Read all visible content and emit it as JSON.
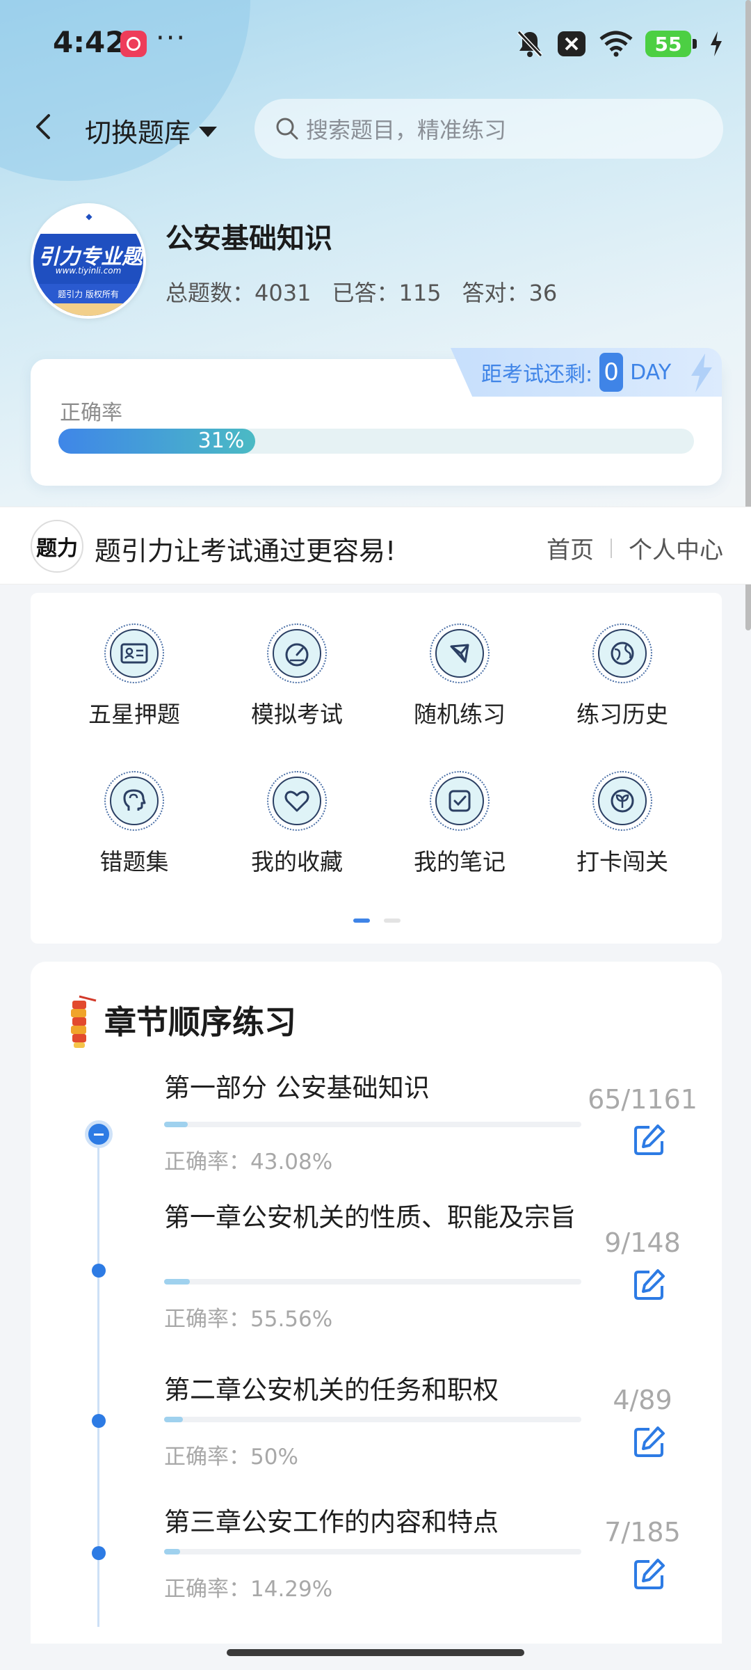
{
  "status_bar": {
    "time": "4:42",
    "dots": "···",
    "battery": "55"
  },
  "header": {
    "switch_label": "切换题库",
    "search_placeholder": "搜索题目，精准练习"
  },
  "logo": {
    "band_text": "引力专业题",
    "url": "www.tiyinli.com",
    "copyright": "题引力 版权所有"
  },
  "bank": {
    "title": "公安基础知识",
    "total_label": "总题数：4031",
    "answered_label": "已答：115",
    "correct_label": "答对：36"
  },
  "accuracy": {
    "label": "正确率",
    "percent_text": "31%",
    "value": 0.31,
    "countdown_label": "距考试还剩:",
    "countdown_days": "0",
    "countdown_unit": "DAY"
  },
  "slogan_bar": {
    "logo_text": "题力",
    "slogan": "题引力让考试通过更容易!",
    "nav_home": "首页",
    "nav_profile": "个人中心"
  },
  "menu": {
    "items": [
      {
        "label": "五星押题",
        "icon": "id-card-icon"
      },
      {
        "label": "模拟考试",
        "icon": "speedometer-icon"
      },
      {
        "label": "随机练习",
        "icon": "network-icon"
      },
      {
        "label": "练习历史",
        "icon": "globe-icon"
      },
      {
        "label": "错题集",
        "icon": "head-icon"
      },
      {
        "label": "我的收藏",
        "icon": "heart-icon"
      },
      {
        "label": "我的笔记",
        "icon": "checklist-icon"
      },
      {
        "label": "打卡闯关",
        "icon": "sprout-icon"
      }
    ]
  },
  "chapters": {
    "title": "章节顺序练习",
    "items": [
      {
        "name": "第一部分 公安基础知识",
        "rate": "正确率：43.08%",
        "count": "65/1161",
        "progress": 0.056
      },
      {
        "name": "第一章公安机关的性质、职能及宗旨",
        "rate": "正确率：55.56%",
        "count": "9/148",
        "progress": 0.061
      },
      {
        "name": "第二章公安机关的任务和职权",
        "rate": "正确率：50%",
        "count": "4/89",
        "progress": 0.045
      },
      {
        "name": "第三章公安工作的内容和特点",
        "rate": "正确率：14.29%",
        "count": "7/185",
        "progress": 0.038
      }
    ]
  },
  "colors": {
    "accent": "#3f84e7",
    "accent_teal": "#4bbac4"
  }
}
